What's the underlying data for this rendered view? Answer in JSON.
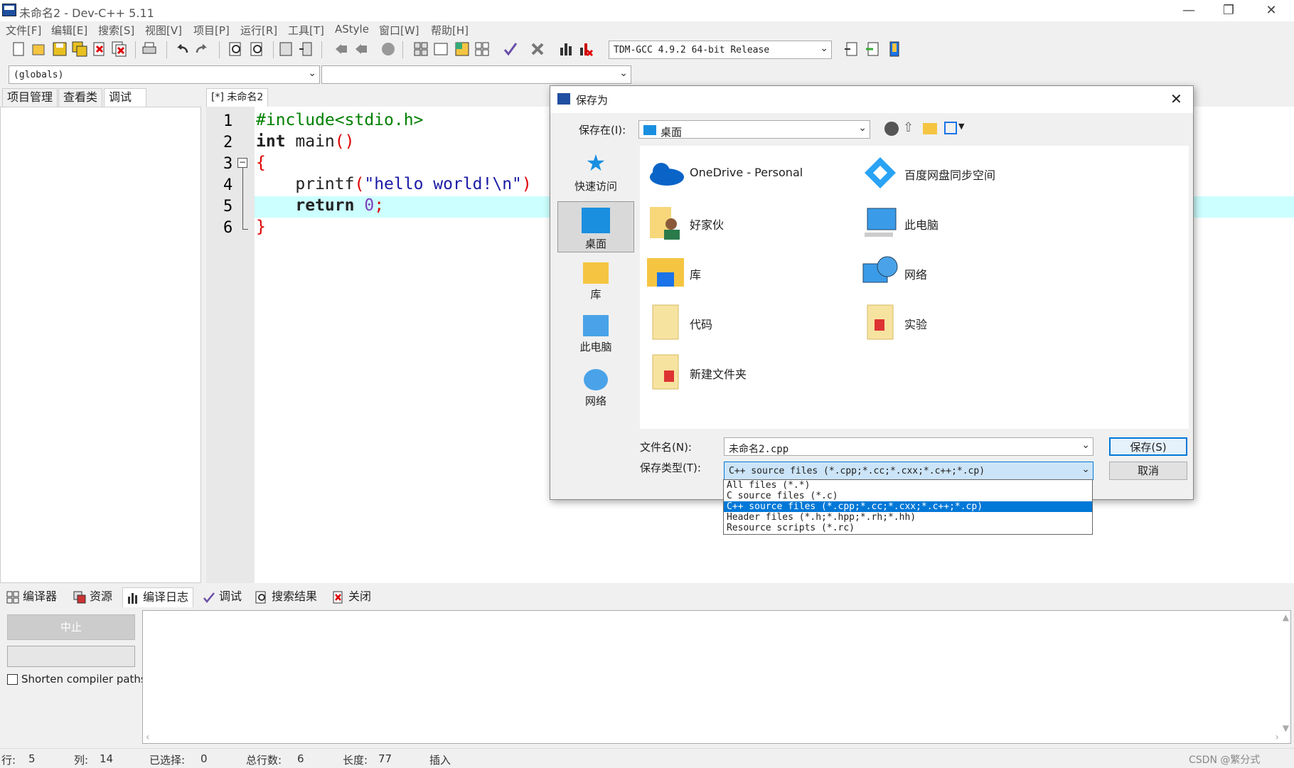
{
  "window": {
    "title": "未命名2 - Dev-C++ 5.11",
    "min": "—",
    "max": "❐",
    "close": "✕"
  },
  "menu": [
    "文件[F]",
    "编辑[E]",
    "搜索[S]",
    "视图[V]",
    "项目[P]",
    "运行[R]",
    "工具[T]",
    "AStyle",
    "窗口[W]",
    "帮助[H]"
  ],
  "toolbar": {
    "compiler": "TDM-GCC 4.9.2 64-bit Release"
  },
  "scope": {
    "globals": "(globals)",
    "second": ""
  },
  "left_tabs": [
    "项目管理",
    "查看类",
    "调试"
  ],
  "editor": {
    "tab": "[*] 未命名2",
    "line_numbers": [
      "1",
      "2",
      "3",
      "4",
      "5",
      "6"
    ],
    "lines": [
      {
        "pre": "#include<stdio.h>"
      },
      {
        "kw": "int",
        "rest": " main",
        "paren": "()"
      },
      {
        "brace": "{"
      },
      {
        "ind": "    printf",
        "p1": "(",
        "str": "\"hello world!\\n\"",
        "p2": ")"
      },
      {
        "ind": "    return ",
        "num": "0",
        "semi": ";"
      },
      {
        "brace": "}"
      }
    ]
  },
  "bottom_tabs": [
    "编译器",
    "资源",
    "编译日志",
    "调试",
    "搜索结果",
    "关闭"
  ],
  "bottom": {
    "abort": "中止",
    "shorten": "Shorten compiler paths"
  },
  "status": {
    "row_label": "行:",
    "row": "5",
    "col_label": "列:",
    "col": "14",
    "sel_label": "已选择:",
    "sel": "0",
    "lines_label": "总行数:",
    "lines": "6",
    "len_label": "长度:",
    "len": "77",
    "mode": "插入",
    "watermark": "CSDN @繁分式"
  },
  "dialog": {
    "title": "保存为",
    "save_in_label": "保存在(I):",
    "save_in_value": "桌面",
    "nav": [
      "快速访问",
      "桌面",
      "库",
      "此电脑",
      "网络"
    ],
    "files": [
      {
        "name": "OneDrive - Personal",
        "icon": "onedrive-icon"
      },
      {
        "name": "百度网盘同步空间",
        "icon": "baidu-netdisk-icon"
      },
      {
        "name": "好家伙",
        "icon": "user-folder-icon"
      },
      {
        "name": "此电脑",
        "icon": "computer-icon"
      },
      {
        "name": "库",
        "icon": "library-icon"
      },
      {
        "name": "网络",
        "icon": "network-icon"
      },
      {
        "name": "代码",
        "icon": "folder-icon"
      },
      {
        "name": "实验",
        "icon": "folder-icon"
      },
      {
        "name": "新建文件夹",
        "icon": "folder-icon"
      }
    ],
    "filename_label": "文件名(N):",
    "filename_value": "未命名2.cpp",
    "filetype_label": "保存类型(T):",
    "filetype_value": "C++ source files (*.cpp;*.cc;*.cxx;*.c++;*.cp)",
    "save_btn": "保存(S)",
    "cancel_btn": "取消",
    "filetype_options": [
      "All files (*.*)",
      "C source files (*.c)",
      "C++ source files (*.cpp;*.cc;*.cxx;*.c++;*.cp)",
      "Header files (*.h;*.hpp;*.rh;*.hh)",
      "Resource scripts (*.rc)"
    ],
    "selected_option": 2
  }
}
